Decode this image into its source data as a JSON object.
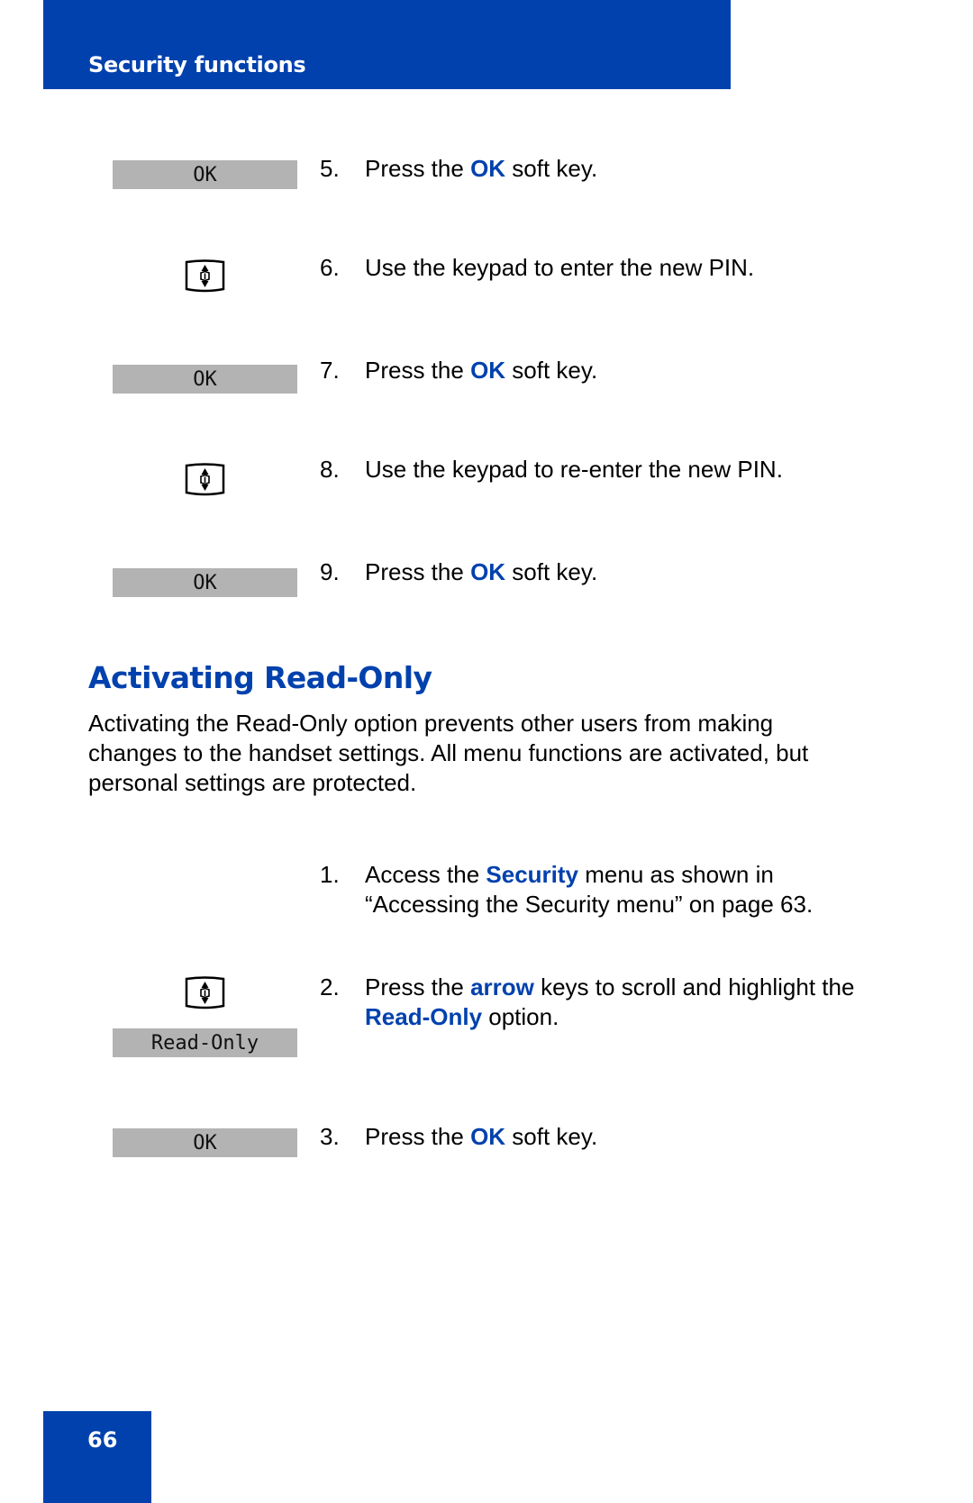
{
  "header": {
    "title": "Security functions",
    "color": "#0041ad"
  },
  "steps_top": [
    {
      "num": "5.",
      "parts": [
        {
          "t": "Press the "
        },
        {
          "t": "OK",
          "hl": true
        },
        {
          "t": " soft key."
        }
      ],
      "graphic": "softkey",
      "graphic_label": "OK"
    },
    {
      "num": "6.",
      "parts": [
        {
          "t": "Use the keypad to enter the new PIN."
        }
      ],
      "graphic": "navigation-key-icon"
    },
    {
      "num": "7.",
      "parts": [
        {
          "t": "Press the "
        },
        {
          "t": "OK",
          "hl": true
        },
        {
          "t": " soft key."
        }
      ],
      "graphic": "softkey",
      "graphic_label": "OK"
    },
    {
      "num": "8.",
      "parts": [
        {
          "t": "Use the keypad to re-enter the new PIN."
        }
      ],
      "graphic": "navigation-key-icon"
    },
    {
      "num": "9.",
      "parts": [
        {
          "t": "Press the "
        },
        {
          "t": "OK",
          "hl": true
        },
        {
          "t": " soft key."
        }
      ],
      "graphic": "softkey",
      "graphic_label": "OK"
    }
  ],
  "section": {
    "title": "Activating Read-Only",
    "paragraph_lines": [
      "Activating the Read-Only option prevents other users from making",
      "changes to the handset settings. All menu functions are activated, but",
      "personal settings are protected."
    ]
  },
  "steps_bottom": [
    {
      "num": "1.",
      "lines": [
        [
          {
            "t": "Access the "
          },
          {
            "t": "Security",
            "hl": true
          },
          {
            "t": " menu as shown in"
          }
        ],
        [
          {
            "t": "“Accessing the Security menu” on page 63."
          }
        ]
      ]
    },
    {
      "num": "2.",
      "lines": [
        [
          {
            "t": "Press the "
          },
          {
            "t": "arrow",
            "hl": true
          },
          {
            "t": " keys to scroll and highlight the"
          }
        ],
        [
          {
            "t": "Read-Only",
            "hl": true
          },
          {
            "t": " option."
          }
        ]
      ],
      "graphic": "navigation-key-icon",
      "display_label": "Read-Only"
    },
    {
      "num": "3.",
      "lines": [
        [
          {
            "t": "Press the "
          },
          {
            "t": "OK",
            "hl": true
          },
          {
            "t": " soft key."
          }
        ]
      ],
      "graphic": "softkey",
      "graphic_label": "OK"
    }
  ],
  "softkeys": {
    "ok": "OK",
    "read_only": "Read-Only"
  },
  "page_number": "66"
}
